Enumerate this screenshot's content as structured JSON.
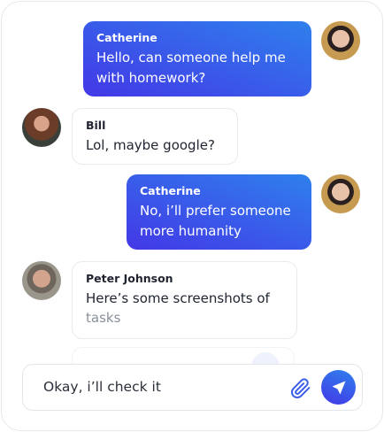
{
  "messages": [
    {
      "sender": "Catherine",
      "text": "Hello, can someone help me with homework?",
      "outgoing": true
    },
    {
      "sender": "Bill",
      "text": "Lol, maybe google?",
      "outgoing": false
    },
    {
      "sender": "Catherine",
      "text": "No, i’ll prefer someone more humanity",
      "outgoing": true
    },
    {
      "sender": "Peter Johnson",
      "text": "Here’s some screenshots of",
      "text_faded": "tasks",
      "outgoing": false
    }
  ],
  "composer": {
    "value": "Okay, i’ll check it",
    "attach_icon": "paperclip-icon",
    "send_icon": "send-icon"
  },
  "colors": {
    "accent_start": "#2f80ed",
    "accent_end": "#4338e6"
  }
}
